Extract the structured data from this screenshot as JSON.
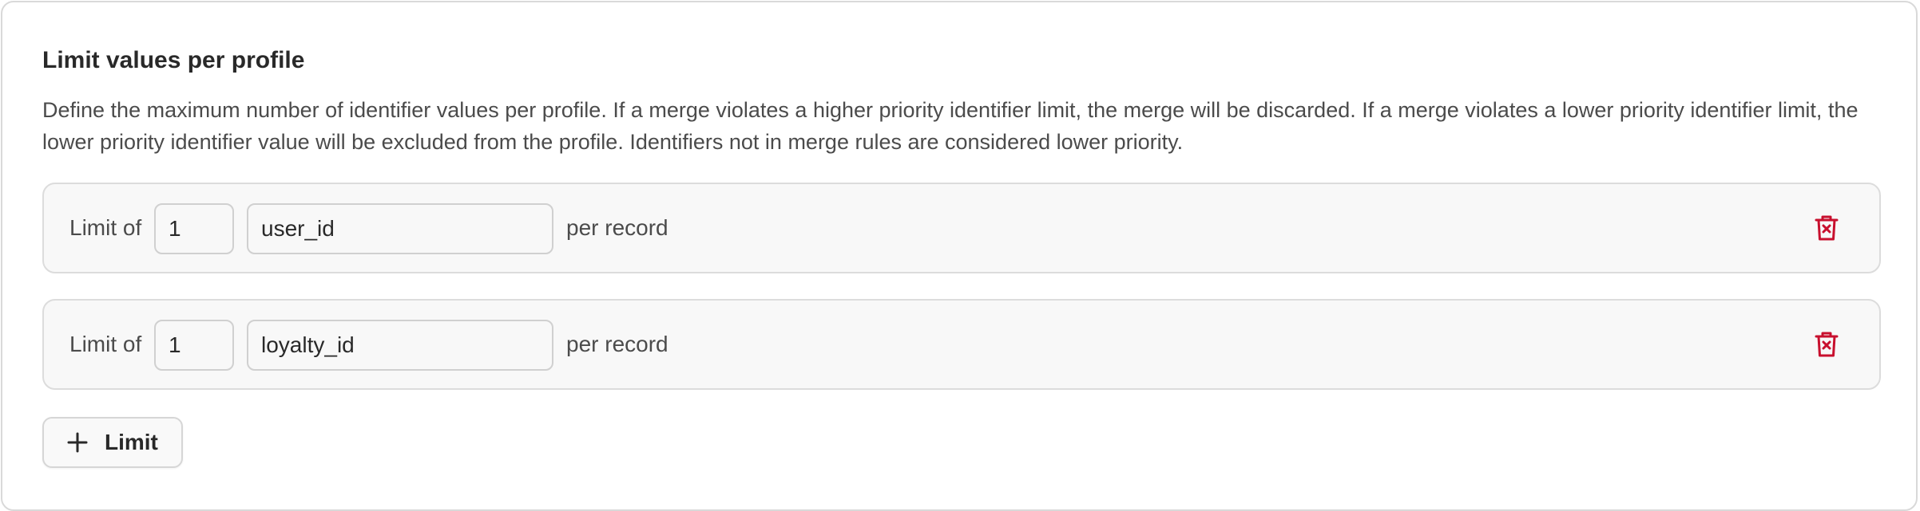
{
  "section": {
    "title": "Limit values per profile",
    "description": "Define the maximum number of identifier values per profile. If a merge violates a higher priority identifier limit, the merge will be discarded. If a merge violates a lower priority identifier limit, the lower priority identifier value will be excluded from the profile. Identifiers not in merge rules are considered lower priority."
  },
  "limits": [
    {
      "prefix_label": "Limit of",
      "count_value": "1",
      "identifier": "user_id",
      "suffix_label": "per record",
      "delete_icon": "trash-x-icon"
    },
    {
      "prefix_label": "Limit of",
      "count_value": "1",
      "identifier": "loyalty_id",
      "suffix_label": "per record",
      "delete_icon": "trash-x-icon"
    }
  ],
  "add_button": {
    "label": "Limit",
    "icon": "plus-icon"
  },
  "colors": {
    "delete_icon": "#c8102e",
    "text_primary": "#292929",
    "text_secondary": "#4b4b4b",
    "row_background": "#f8f8f8",
    "border": "#d9d9d9"
  }
}
